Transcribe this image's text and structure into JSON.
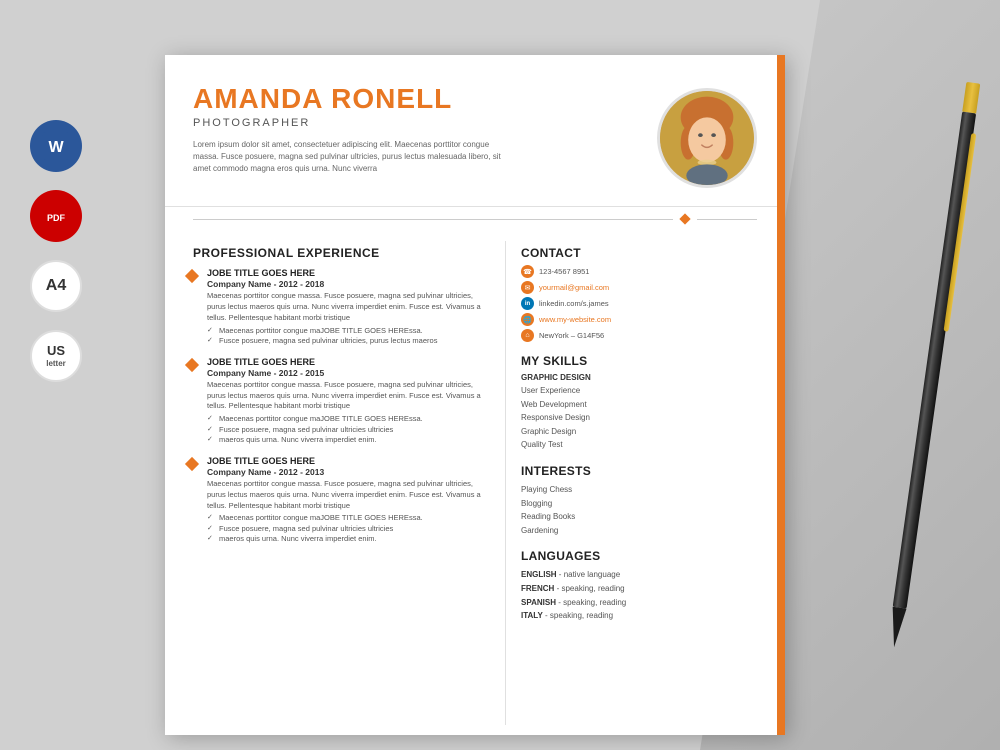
{
  "background": {
    "color": "#d0d0d0"
  },
  "leftIcons": [
    {
      "id": "word",
      "label": "W",
      "type": "word"
    },
    {
      "id": "pdf",
      "label": "PDF",
      "type": "pdf"
    },
    {
      "id": "a4",
      "label": "A4",
      "type": "a4"
    },
    {
      "id": "us",
      "label": "US letter",
      "type": "us"
    }
  ],
  "resume": {
    "header": {
      "name": "AMANDA RONELL",
      "title": "PHOTOGRAPHER",
      "summary": "Lorem ipsum dolor sit amet, consectetuer adipiscing elit. Maecenas porttitor congue massa. Fusce posuere, magna sed pulvinar ultricies, purus lectus malesuada libero, sit amet commodo magna eros quis urna. Nunc viverra"
    },
    "sections": {
      "experience": {
        "title": "PROFESSIONAL EXPERIENCE",
        "items": [
          {
            "jobTitle": "JOBE TITLE GOES HERE",
            "company": "Company Name  - 2012 - 2018",
            "description": "Maecenas porttitor congue massa. Fusce posuere, magna sed pulvinar ultricies, purus lectus maeros quis urna. Nunc viverra imperdiet enim. Fusce est. Vivamus a tellus. Pellentesque habitant morbi tristique",
            "bullets": [
              "Maecenas porttitor congue maJOBE TITLE GOES HEREssa.",
              "Fusce posuere, magna sed pulvinar ultricies, purus lectus maeros"
            ]
          },
          {
            "jobTitle": "JOBE TITLE GOES HERE",
            "company": "Company Name  - 2012 - 2015",
            "description": "Maecenas porttitor congue massa. Fusce posuere, magna sed pulvinar ultricies, purus lectus maeros quis urna. Nunc viverra imperdiet enim. Fusce est. Vivamus a tellus. Pellentesque habitant morbi tristique",
            "bullets": [
              "Maecenas porttitor congue maJOBE TITLE GOES HEREssa.",
              "Fusce posuere, magna sed pulvinar ultricies ultricies",
              "maeros quis urna. Nunc viverra imperdiet enim."
            ]
          },
          {
            "jobTitle": "JOBE TITLE GOES HERE",
            "company": "Company Name  - 2012 - 2013",
            "description": "Maecenas porttitor congue massa. Fusce posuere, magna sed pulvinar ultricies, purus lectus maeros quis urna. Nunc viverra imperdiet enim. Fusce est. Vivamus a tellus. Pellentesque habitant morbi tristique",
            "bullets": [
              "Maecenas porttitor congue maJOBE TITLE GOES HEREssa.",
              "Fusce posuere, magna sed pulvinar ultricies ultricies",
              "maeros quis urna. Nunc viverra imperdiet enim."
            ]
          }
        ]
      },
      "contact": {
        "title": "CONTACT",
        "phone": "123-4567 8951",
        "email": "yourmail@gmail.com",
        "linkedin": "linkedin.com/s.james",
        "website": "www.my-website.com",
        "location": "NewYork – G14F56"
      },
      "skills": {
        "title": "MY SKILLS",
        "highlight": "GRAPHIC DESIGN",
        "items": [
          "User Experience",
          "Web Development",
          "Responsive Design",
          "Graphic Design",
          "Quality Test"
        ]
      },
      "interests": {
        "title": "INTERESTS",
        "items": [
          "Playing Chess",
          "Blogging",
          "Reading Books",
          "Gardening"
        ]
      },
      "languages": {
        "title": "LANGUAGES",
        "items": [
          {
            "name": "ENGLISH",
            "level": "native language"
          },
          {
            "name": "FRENCH",
            "level": "speaking, reading"
          },
          {
            "name": "SPANISH",
            "level": "speaking, reading"
          },
          {
            "name": "ITALY",
            "level": "speaking, reading"
          }
        ]
      }
    }
  }
}
